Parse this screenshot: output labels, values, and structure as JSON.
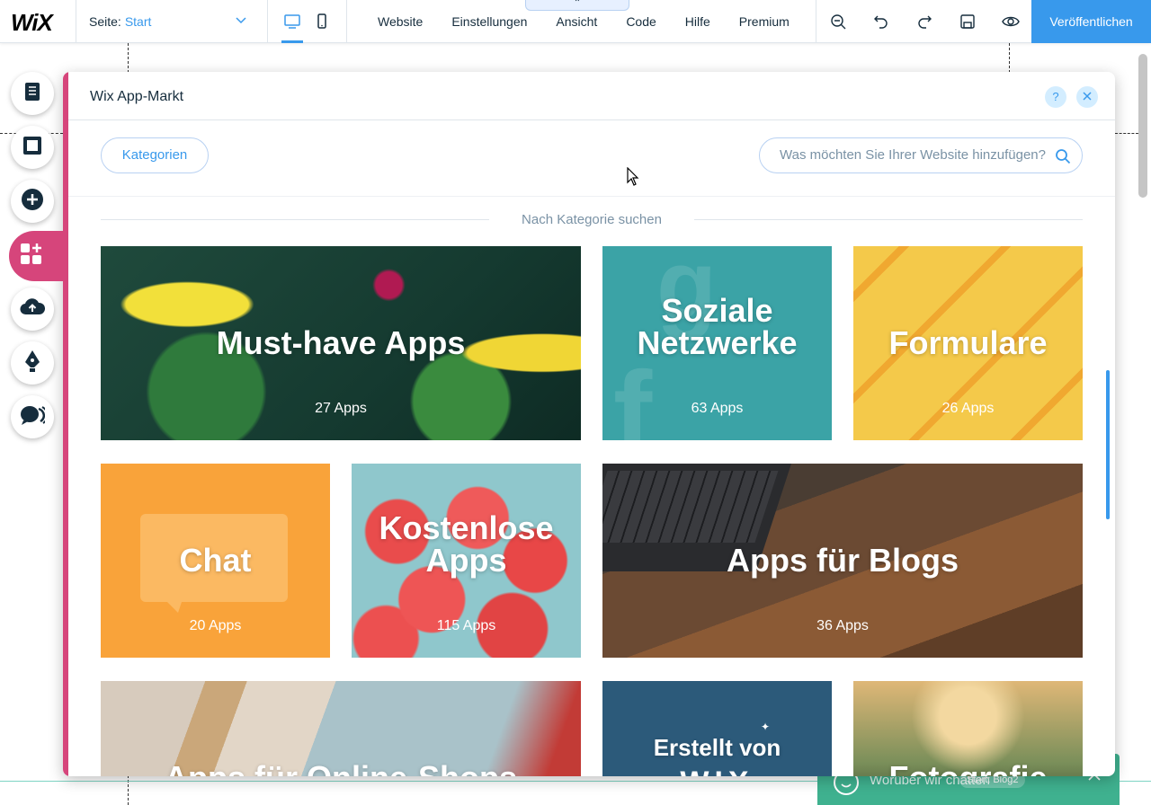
{
  "topbar": {
    "logo": "WiX",
    "page_label": "Seite:",
    "page_value": "Start",
    "menu": [
      "Website",
      "Einstellungen",
      "Ansicht",
      "Code",
      "Hilfe",
      "Premium"
    ],
    "collapse_glyph": "⌃",
    "publish_label": "Veröffentlichen",
    "tools": [
      "zoom-out-icon",
      "undo-icon",
      "redo-icon",
      "save-icon",
      "preview-icon"
    ]
  },
  "left_tools": [
    "menus-pages-icon",
    "background-icon",
    "add-icon",
    "app-market-icon",
    "media-upload-icon",
    "blog-pen-icon",
    "chat-icon"
  ],
  "panel": {
    "title": "Wix App-Markt",
    "help": "?",
    "categories_button": "Kategorien",
    "search_placeholder": "Was möchten Sie Ihrer Website hinzufügen?",
    "section_title": "Nach Kategorie suchen",
    "tiles": [
      {
        "title": "Must-have Apps",
        "count": "27 Apps"
      },
      {
        "title": "Soziale Netzwerke",
        "count": "63 Apps"
      },
      {
        "title": "Formulare",
        "count": "26 Apps"
      },
      {
        "title": "Chat",
        "count": "20 Apps"
      },
      {
        "title": "Kostenlose Apps",
        "count": "115 Apps"
      },
      {
        "title": "Apps für Blogs",
        "count": "36 Apps"
      },
      {
        "title": "Apps für Online-Shops",
        "count": ""
      },
      {
        "title": "Erstellt von",
        "count": ""
      },
      {
        "title": "Fotografie",
        "count": ""
      }
    ],
    "wix_brand": "WIX"
  },
  "chat_widget": {
    "text": "Worüber wir chatten",
    "badge": "Start: Blog2"
  },
  "colors": {
    "accent": "#3899ec",
    "app_market_pink": "#d6457b",
    "chat_green": "#3fb18f"
  }
}
